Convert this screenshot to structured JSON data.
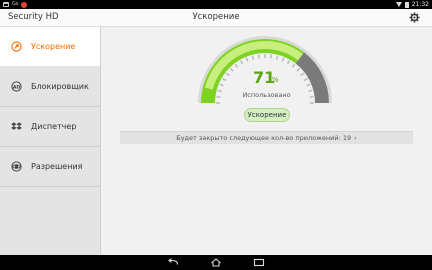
{
  "status_bar": {
    "time": "21:32",
    "left_icons": [
      "shopping-bag-icon",
      "gs-icon",
      "notification-dot-icon"
    ],
    "right_icons": [
      "wifi-icon",
      "battery-icon"
    ]
  },
  "action_bar": {
    "app_title": "Security HD",
    "page_title": "Ускорение",
    "settings_icon": "gear-icon"
  },
  "sidebar": {
    "items": [
      {
        "label": "Ускорение",
        "icon": "rocket-icon",
        "active": true
      },
      {
        "label": "Блокировщик",
        "icon": "ad-block-icon",
        "active": false
      },
      {
        "label": "Диспетчер",
        "icon": "dropbox-icon",
        "active": false
      },
      {
        "label": "Разрешения",
        "icon": "eye-icon",
        "active": false
      }
    ]
  },
  "main": {
    "gauge": {
      "percent_value": "71",
      "percent_sign": "%",
      "label": "Использовано",
      "level": 0.71,
      "colors": {
        "used": "#7ed321",
        "free": "#7a7a7a",
        "highlight": "#c8ee7e"
      }
    },
    "boost_button": "Ускорение",
    "info_text": "Будет закрыто следующее кол-во приложений: 19",
    "info_chevron": "›"
  },
  "colors": {
    "accent": "#ef6c00",
    "green": "#5ca415"
  },
  "nav_bar": {
    "icons": [
      "back-icon",
      "home-icon",
      "recents-icon"
    ]
  }
}
